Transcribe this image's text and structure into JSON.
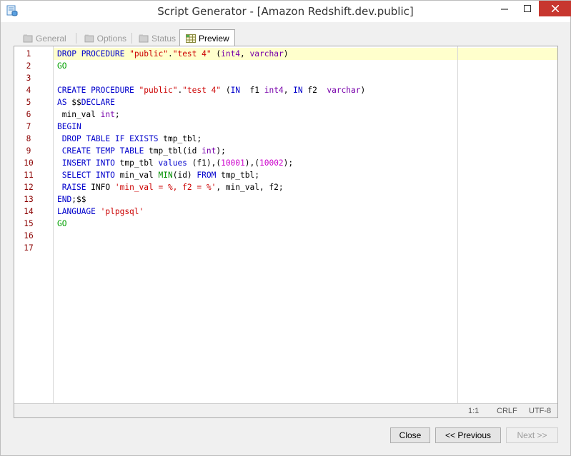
{
  "window": {
    "title": "Script Generator - [Amazon Redshift.dev.public]",
    "icons": {
      "app": "database-script-icon",
      "minimize": "minimize-icon",
      "maximize": "maximize-icon",
      "close": "close-icon"
    }
  },
  "tabs": [
    {
      "label": "General",
      "icon": "general-icon",
      "active": false
    },
    {
      "label": "Options",
      "icon": "options-icon",
      "active": false
    },
    {
      "label": "Status",
      "icon": "status-icon",
      "active": false
    },
    {
      "label": "Preview",
      "icon": "grid-preview-icon",
      "active": true
    }
  ],
  "editor": {
    "line_numbers": [
      "1",
      "2",
      "3",
      "4",
      "5",
      "6",
      "7",
      "8",
      "9",
      "10",
      "11",
      "12",
      "13",
      "14",
      "15",
      "16",
      "17"
    ],
    "current_line": 1,
    "lines": [
      "DROP PROCEDURE \"public\".\"test 4\" (int4, varchar)",
      "GO",
      "",
      "CREATE PROCEDURE \"public\".\"test 4\" (IN  f1 int4, IN f2  varchar)",
      "AS $$DECLARE",
      " min_val int;",
      "BEGIN",
      " DROP TABLE IF EXISTS tmp_tbl;",
      " CREATE TEMP TABLE tmp_tbl(id int);",
      " INSERT INTO tmp_tbl values (f1),(10001),(10002);",
      " SELECT INTO min_val MIN(id) FROM tmp_tbl;",
      " RAISE INFO 'min_val = %, f2 = %', min_val, f2;",
      "END;$$",
      "LANGUAGE 'plpgsql'",
      "GO",
      "",
      ""
    ]
  },
  "statusbar": {
    "position": "1:1",
    "line_ending": "CRLF",
    "encoding": "UTF-8"
  },
  "buttons": {
    "close": "Close",
    "previous": "<< Previous",
    "next": "Next >>"
  },
  "colors": {
    "keyword": "#0000cc",
    "type": "#7700aa",
    "string": "#cc0000",
    "number": "#cc00cc",
    "go": "#00a000",
    "line_number": "#8b0000",
    "current_line": "#ffffcc",
    "close_button": "#c7372f"
  }
}
